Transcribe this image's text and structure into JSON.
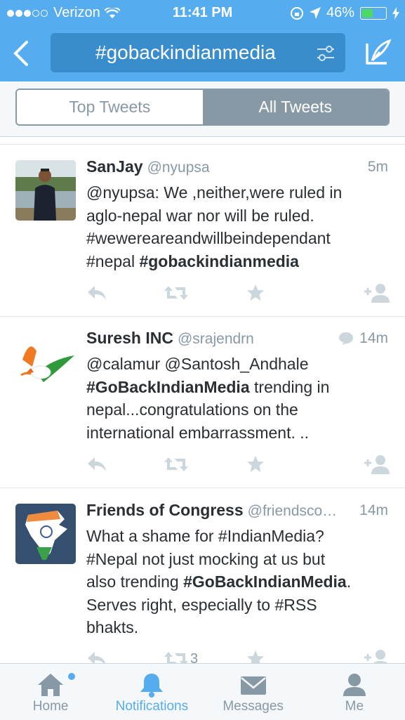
{
  "status": {
    "carrier": "Verizon",
    "time": "11:41 PM",
    "battery": "46%"
  },
  "search": {
    "query": "#gobackindianmedia"
  },
  "segments": {
    "top": "Top Tweets",
    "all": "All Tweets",
    "selected": "all"
  },
  "tweets": [
    {
      "name": "SanJay",
      "handle": "@nyupsa",
      "time": "5m",
      "lines": [
        "@nyupsa: We ,neither,were ruled in",
        "aglo-nepal war nor will be ruled.",
        "#wewereareandwillbeindependant"
      ],
      "last_prefix": "#nepal ",
      "last_bold": "#gobackindianmedia",
      "retweets": ""
    },
    {
      "name": "Suresh INC",
      "handle": "@srajendrn",
      "time": "14m",
      "line1": "@calamur @Santosh_Andhale",
      "bold2": "#GoBackIndianMedia",
      "rest2": " trending in",
      "line3": "nepal...congratulations on the",
      "line4": "international embarrassment. .."
    },
    {
      "name": "Friends of Congress",
      "handle": "@friendsco…",
      "time": "14m",
      "line1": "What a shame for #IndianMedia?",
      "line2": "#Nepal not just mocking at us but",
      "pre3": "also trending ",
      "bold3": "#GoBackIndianMedia",
      "post3": ".",
      "line4": "Serves right, especially to #RSS",
      "line5": "bhakts.",
      "retweets": "3"
    }
  ],
  "tabs": [
    {
      "label": "Home"
    },
    {
      "label": "Notifications"
    },
    {
      "label": "Messages"
    },
    {
      "label": "Me"
    }
  ],
  "colors": {
    "brand": "#55acee",
    "muted": "#8899a6",
    "text": "#292f33"
  }
}
